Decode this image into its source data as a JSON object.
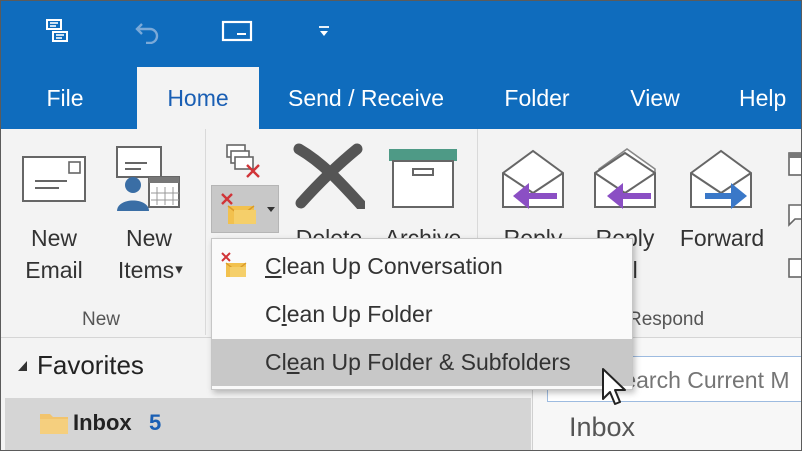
{
  "qat": {
    "icons": [
      "send-receive-all-icon",
      "undo-icon",
      "email-envelope-icon",
      "customize-qat-dropdown-icon"
    ]
  },
  "tabs": [
    {
      "label": "File",
      "active": false
    },
    {
      "label": "Home",
      "active": true
    },
    {
      "label": "Send / Receive",
      "active": false
    },
    {
      "label": "Folder",
      "active": false
    },
    {
      "label": "View",
      "active": false
    },
    {
      "label": "Help",
      "active": false
    }
  ],
  "ribbon": {
    "new_email": {
      "line1": "New",
      "line2": "Email"
    },
    "new_items": {
      "line1": "New",
      "line2": "Items",
      "caret": "▾"
    },
    "group_new": "New",
    "delete_label": "Delete",
    "archive_label": "Archive",
    "reply_label": "Reply",
    "reply_all": {
      "line1": "Reply",
      "line2": "All"
    },
    "forward_label": "Forward",
    "group_respond": "Respond"
  },
  "cleanup_menu": {
    "items": [
      {
        "pre": "",
        "accel": "C",
        "post": "lean Up Conversation",
        "hover": false
      },
      {
        "pre": "C",
        "accel": "l",
        "post": "ean Up Folder",
        "hover": false
      },
      {
        "pre": "Cl",
        "accel": "e",
        "post": "an Up Folder & Subfolders",
        "hover": true
      }
    ]
  },
  "favorites": {
    "heading": "Favorites",
    "inbox_label": "Inbox",
    "inbox_count": "5"
  },
  "search": {
    "placeholder": "Search Current M"
  },
  "folder_title": "Inbox",
  "colors": {
    "brand_blue": "#0f6cbd",
    "hover_gray": "#c8c8c8",
    "count_blue": "#1a5fb4",
    "purple_arrow": "#8b4fc4",
    "blue_arrow": "#3a78c8",
    "red_x": "#d13438"
  }
}
